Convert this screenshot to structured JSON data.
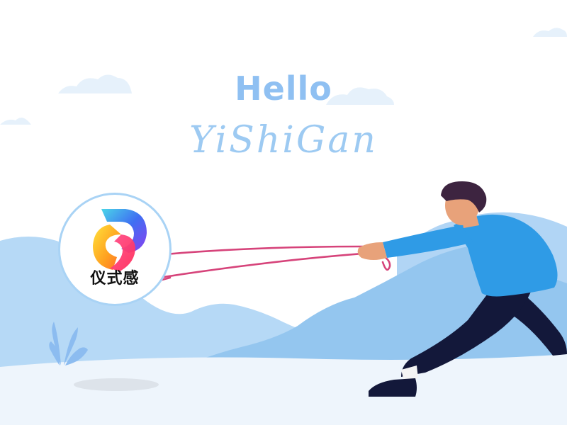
{
  "headline": "Hello",
  "brand_name": "YiShiGan",
  "logo": {
    "caption": "仪式感",
    "icon": "yishigan-app-logo"
  },
  "colors": {
    "sky": "#ffffff",
    "mountain_light": "#b6d9f6",
    "mountain_mid": "#94c6ef",
    "ground": "#eef5fc",
    "rope": "#d6437a",
    "shirt": "#2f9be6",
    "trousers": "#13183a",
    "hair": "#3d2440",
    "skin": "#e8a27a"
  }
}
